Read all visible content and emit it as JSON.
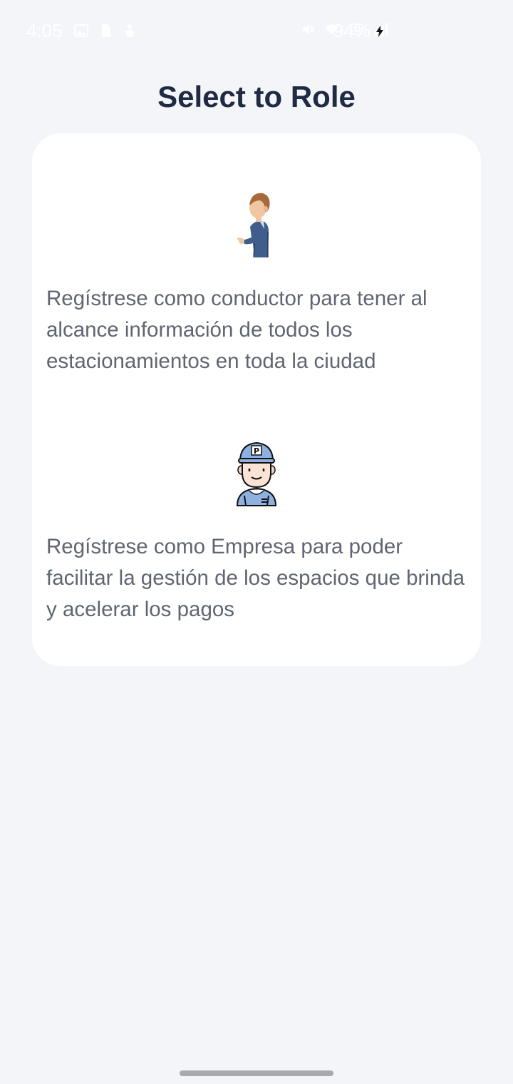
{
  "status_bar": {
    "time": "4:05",
    "battery": "94%",
    "icons_left": [
      "gallery-icon",
      "sim-icon",
      "accessibility-icon"
    ],
    "icons_right": [
      "mute-icon",
      "wifi-icon",
      "volte-icon",
      "signal-icon"
    ]
  },
  "page": {
    "title": "Select to Role"
  },
  "roles": [
    {
      "id": "driver",
      "illustration": "driver-avatar-icon",
      "description": "Regístrese como conductor para tener al alcance información de todos los estacionamientos en toda la ciudad"
    },
    {
      "id": "company",
      "illustration": "parking-attendant-avatar-icon",
      "description": "Regístrese como Empresa para poder facilitar la gestión de los espacios que brinda y acelerar los pagos"
    }
  ],
  "colors": {
    "background": "#f4f5f9",
    "card": "#ffffff",
    "title": "#1f2a44",
    "body_text": "#5f6572",
    "home_indicator": "#a8aab0"
  }
}
